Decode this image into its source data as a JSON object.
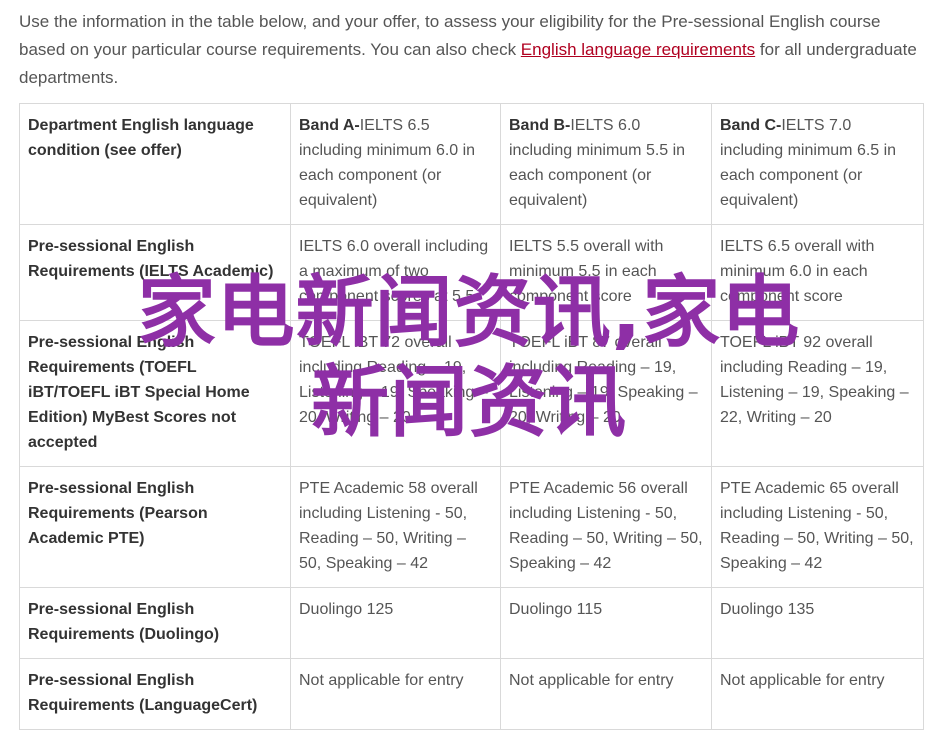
{
  "intro": {
    "text_before": "Use the information in the table below, and your offer, to assess your eligibility for the Pre-sessional English course based on your particular course requirements. You can also check ",
    "link": "English language requirements",
    "text_after": " for all undergraduate departments."
  },
  "table": {
    "header": {
      "label": "Department English language condition (see offer)",
      "bands": [
        {
          "name": "Band A-",
          "rest": "IELTS 6.5 including minimum 6.0 in each component (or equivalent)"
        },
        {
          "name": "Band B-",
          "rest": "IELTS 6.0 including minimum 5.5 in each component (or equivalent)"
        },
        {
          "name": "Band C-",
          "rest": "IELTS 7.0 including minimum 6.5 in each component (or equivalent)"
        }
      ]
    },
    "rows": [
      {
        "label": "Pre-sessional English Requirements (IELTS Academic)",
        "cells": [
          "IELTS 6.0 overall including a maximum of two component scores at 5.5",
          "IELTS 5.5 overall with minimum 5.5 in each component score",
          "IELTS 6.5 overall with minimum 6.0 in each component score"
        ]
      },
      {
        "label": "Pre-sessional English Requirements (TOEFL iBT/TOEFL iBT Special Home Edition) MyBest Scores not accepted",
        "cells": [
          "TOEFL iBT 72 overall including Reading – 19, Listening – 19, Speaking – 20, Writing – 20",
          "TOEFL iBT 87 overall including Reading – 19, Listening – 19, Speaking – 20, Writing – 20",
          "TOEFL iBT 92 overall including Reading – 19, Listening – 19, Speaking – 22, Writing – 20"
        ]
      },
      {
        "label": "Pre-sessional English Requirements (Pearson Academic PTE)",
        "cells": [
          "PTE Academic 58 overall including Listening - 50, Reading – 50, Writing – 50, Speaking – 42",
          "PTE Academic 56 overall including Listening - 50, Reading – 50, Writing – 50, Speaking – 42",
          "PTE Academic 65 overall including Listening - 50, Reading – 50, Writing – 50, Speaking – 42"
        ]
      },
      {
        "label": "Pre-sessional English Requirements (Duolingo)",
        "cells": [
          "Duolingo 125",
          "Duolingo 115",
          "Duolingo 135"
        ]
      },
      {
        "label": "Pre-sessional English Requirements (LanguageCert)",
        "cells": [
          "Not applicable for entry",
          "Not applicable for entry",
          "Not applicable for entry"
        ]
      }
    ]
  },
  "watermark": {
    "line1": "家电新闻资讯,家电",
    "line2": "新闻资讯",
    "color": "#8e2fa6"
  }
}
